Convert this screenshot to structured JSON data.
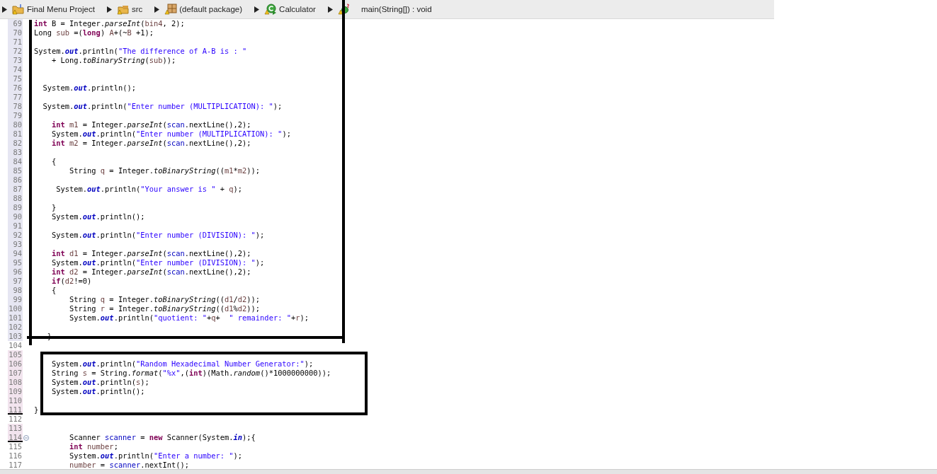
{
  "breadcrumb": [
    {
      "label": "Final Menu Project",
      "kind": "project"
    },
    {
      "label": "src",
      "kind": "folder"
    },
    {
      "label": "(default package)",
      "kind": "package"
    },
    {
      "label": "Calculator",
      "kind": "class"
    },
    {
      "label": "main(String[]) : void",
      "kind": "method"
    }
  ],
  "lines": [
    {
      "number": "69",
      "kind": "tinted",
      "tokens": [
        {
          "kind": "keyword",
          "text": "int"
        },
        {
          "kind": "plain",
          "text": " B = Integer."
        },
        {
          "kind": "static",
          "text": "parseInt"
        },
        {
          "kind": "plain",
          "text": "("
        },
        {
          "kind": "local",
          "text": "bin4"
        },
        {
          "kind": "plain",
          "text": ", 2);"
        }
      ]
    },
    {
      "number": "70",
      "kind": "tinted",
      "tokens": [
        {
          "kind": "plain",
          "text": "Long "
        },
        {
          "kind": "local",
          "text": "sub"
        },
        {
          "kind": "plain",
          "text": " =("
        },
        {
          "kind": "keyword",
          "text": "long"
        },
        {
          "kind": "plain",
          "text": ") "
        },
        {
          "kind": "local",
          "text": "A"
        },
        {
          "kind": "plain",
          "text": "+(~"
        },
        {
          "kind": "local",
          "text": "B"
        },
        {
          "kind": "plain",
          "text": " +1);"
        }
      ]
    },
    {
      "number": "71",
      "kind": "tinted"
    },
    {
      "number": "72",
      "kind": "tinted",
      "tokens": [
        {
          "kind": "plain",
          "text": "System."
        },
        {
          "kind": "field",
          "text": "out"
        },
        {
          "kind": "plain",
          "text": ".println("
        },
        {
          "kind": "string",
          "text": "\"The difference of A-B is : \""
        }
      ]
    },
    {
      "number": "73",
      "kind": "tinted",
      "tokens": [
        {
          "kind": "plain",
          "text": "    + Long."
        },
        {
          "kind": "static",
          "text": "toBinaryString"
        },
        {
          "kind": "plain",
          "text": "("
        },
        {
          "kind": "local",
          "text": "sub"
        },
        {
          "kind": "plain",
          "text": "));"
        }
      ]
    },
    {
      "number": "74",
      "kind": "tinted"
    },
    {
      "number": "75",
      "kind": "tinted"
    },
    {
      "number": "76",
      "kind": "tinted",
      "tokens": [
        {
          "kind": "plain",
          "text": "  System."
        },
        {
          "kind": "field",
          "text": "out"
        },
        {
          "kind": "plain",
          "text": ".println();"
        }
      ]
    },
    {
      "number": "77",
      "kind": "tinted"
    },
    {
      "number": "78",
      "kind": "tinted",
      "tokens": [
        {
          "kind": "plain",
          "text": "  System."
        },
        {
          "kind": "field",
          "text": "out"
        },
        {
          "kind": "plain",
          "text": ".println("
        },
        {
          "kind": "string",
          "text": "\"Enter number (MULTIPLICATION): \""
        },
        {
          "kind": "plain",
          "text": ");"
        }
      ]
    },
    {
      "number": "79",
      "kind": "tinted"
    },
    {
      "number": "80",
      "kind": "tinted",
      "tokens": [
        {
          "kind": "keyword",
          "text": "    int"
        },
        {
          "kind": "local",
          "text": " m1"
        },
        {
          "kind": "plain",
          "text": " = Integer."
        },
        {
          "kind": "static",
          "text": "parseInt"
        },
        {
          "kind": "plain",
          "text": "("
        },
        {
          "kind": "member",
          "text": "scan"
        },
        {
          "kind": "plain",
          "text": ".nextLine(),2);"
        }
      ]
    },
    {
      "number": "81",
      "kind": "tinted",
      "tokens": [
        {
          "kind": "plain",
          "text": "    System."
        },
        {
          "kind": "field",
          "text": "out"
        },
        {
          "kind": "plain",
          "text": ".println("
        },
        {
          "kind": "string",
          "text": "\"Enter number (MULTIPLICATION): \""
        },
        {
          "kind": "plain",
          "text": ");"
        }
      ]
    },
    {
      "number": "82",
      "kind": "tinted",
      "tokens": [
        {
          "kind": "keyword",
          "text": "    int"
        },
        {
          "kind": "local",
          "text": " m2"
        },
        {
          "kind": "plain",
          "text": " = Integer."
        },
        {
          "kind": "static",
          "text": "parseInt"
        },
        {
          "kind": "plain",
          "text": "("
        },
        {
          "kind": "member",
          "text": "scan"
        },
        {
          "kind": "plain",
          "text": ".nextLine(),2);"
        }
      ]
    },
    {
      "number": "83",
      "kind": "tinted"
    },
    {
      "number": "84",
      "kind": "tinted",
      "tokens": [
        {
          "kind": "plain",
          "text": "    {"
        }
      ]
    },
    {
      "number": "85",
      "kind": "tinted",
      "tokens": [
        {
          "kind": "plain",
          "text": "        String "
        },
        {
          "kind": "local",
          "text": "q"
        },
        {
          "kind": "plain",
          "text": " = Integer."
        },
        {
          "kind": "static",
          "text": "toBinaryString"
        },
        {
          "kind": "plain",
          "text": "(("
        },
        {
          "kind": "local",
          "text": "m1"
        },
        {
          "kind": "plain",
          "text": "*"
        },
        {
          "kind": "local",
          "text": "m2"
        },
        {
          "kind": "plain",
          "text": "));"
        }
      ]
    },
    {
      "number": "86",
      "kind": "tinted"
    },
    {
      "number": "87",
      "kind": "tinted",
      "tokens": [
        {
          "kind": "plain",
          "text": "     System."
        },
        {
          "kind": "field",
          "text": "out"
        },
        {
          "kind": "plain",
          "text": ".println("
        },
        {
          "kind": "string",
          "text": "\"Your answer is \""
        },
        {
          "kind": "plain",
          "text": " + "
        },
        {
          "kind": "local",
          "text": "q"
        },
        {
          "kind": "plain",
          "text": ");"
        }
      ]
    },
    {
      "number": "88",
      "kind": "tinted"
    },
    {
      "number": "89",
      "kind": "tinted",
      "tokens": [
        {
          "kind": "plain",
          "text": "    }"
        }
      ]
    },
    {
      "number": "90",
      "kind": "tinted",
      "tokens": [
        {
          "kind": "plain",
          "text": "    System."
        },
        {
          "kind": "field",
          "text": "out"
        },
        {
          "kind": "plain",
          "text": ".println();"
        }
      ]
    },
    {
      "number": "91",
      "kind": "tinted"
    },
    {
      "number": "92",
      "kind": "tinted",
      "tokens": [
        {
          "kind": "plain",
          "text": "    System."
        },
        {
          "kind": "field",
          "text": "out"
        },
        {
          "kind": "plain",
          "text": ".println("
        },
        {
          "kind": "string",
          "text": "\"Enter number (DIVISION): \""
        },
        {
          "kind": "plain",
          "text": ");"
        }
      ]
    },
    {
      "number": "93",
      "kind": "tinted"
    },
    {
      "number": "94",
      "kind": "tinted",
      "tokens": [
        {
          "kind": "keyword",
          "text": "    int"
        },
        {
          "kind": "local",
          "text": " d1"
        },
        {
          "kind": "plain",
          "text": " = Integer."
        },
        {
          "kind": "static",
          "text": "parseInt"
        },
        {
          "kind": "plain",
          "text": "("
        },
        {
          "kind": "member",
          "text": "scan"
        },
        {
          "kind": "plain",
          "text": ".nextLine(),2);"
        }
      ]
    },
    {
      "number": "95",
      "kind": "tinted",
      "tokens": [
        {
          "kind": "plain",
          "text": "    System."
        },
        {
          "kind": "field",
          "text": "out"
        },
        {
          "kind": "plain",
          "text": ".println("
        },
        {
          "kind": "string",
          "text": "\"Enter number (DIVISION): \""
        },
        {
          "kind": "plain",
          "text": ");"
        }
      ]
    },
    {
      "number": "96",
      "kind": "tinted",
      "tokens": [
        {
          "kind": "keyword",
          "text": "    int"
        },
        {
          "kind": "local",
          "text": " d2"
        },
        {
          "kind": "plain",
          "text": " = Integer."
        },
        {
          "kind": "static",
          "text": "parseInt"
        },
        {
          "kind": "plain",
          "text": "("
        },
        {
          "kind": "member",
          "text": "scan"
        },
        {
          "kind": "plain",
          "text": ".nextLine(),2);"
        }
      ]
    },
    {
      "number": "97",
      "kind": "tinted",
      "tokens": [
        {
          "kind": "keyword",
          "text": "    if"
        },
        {
          "kind": "plain",
          "text": "("
        },
        {
          "kind": "local",
          "text": "d2"
        },
        {
          "kind": "plain",
          "text": "!=0)"
        }
      ]
    },
    {
      "number": "98",
      "kind": "tinted",
      "tokens": [
        {
          "kind": "plain",
          "text": "    {"
        }
      ]
    },
    {
      "number": "99",
      "kind": "tinted",
      "tokens": [
        {
          "kind": "plain",
          "text": "        String "
        },
        {
          "kind": "local",
          "text": "q"
        },
        {
          "kind": "plain",
          "text": " = Integer."
        },
        {
          "kind": "static",
          "text": "toBinaryString"
        },
        {
          "kind": "plain",
          "text": "(("
        },
        {
          "kind": "local",
          "text": "d1"
        },
        {
          "kind": "plain",
          "text": "/"
        },
        {
          "kind": "local",
          "text": "d2"
        },
        {
          "kind": "plain",
          "text": "));"
        }
      ]
    },
    {
      "number": "100",
      "kind": "tinted",
      "tokens": [
        {
          "kind": "plain",
          "text": "        String "
        },
        {
          "kind": "local",
          "text": "r"
        },
        {
          "kind": "plain",
          "text": " = Integer."
        },
        {
          "kind": "static",
          "text": "toBinaryString"
        },
        {
          "kind": "plain",
          "text": "(("
        },
        {
          "kind": "local",
          "text": "d1"
        },
        {
          "kind": "plain",
          "text": "%"
        },
        {
          "kind": "local",
          "text": "d2"
        },
        {
          "kind": "plain",
          "text": "));"
        }
      ]
    },
    {
      "number": "101",
      "kind": "tinted",
      "tokens": [
        {
          "kind": "plain",
          "text": "        System."
        },
        {
          "kind": "field",
          "text": "out"
        },
        {
          "kind": "plain",
          "text": ".println("
        },
        {
          "kind": "string",
          "text": "\"quotient: \""
        },
        {
          "kind": "plain",
          "text": "+"
        },
        {
          "kind": "local",
          "text": "q"
        },
        {
          "kind": "plain",
          "text": "+  "
        },
        {
          "kind": "string",
          "text": "\" remainder: \""
        },
        {
          "kind": "plain",
          "text": "+"
        },
        {
          "kind": "local",
          "text": "r"
        },
        {
          "kind": "plain",
          "text": ");"
        }
      ]
    },
    {
      "number": "102",
      "kind": "tinted"
    },
    {
      "number": "103",
      "kind": "tinted",
      "tokens": [
        {
          "kind": "plain",
          "text": "   }"
        }
      ]
    },
    {
      "number": "104",
      "kind": "plain"
    },
    {
      "number": "105",
      "kind": "changed"
    },
    {
      "number": "106",
      "kind": "changed",
      "tokens": [
        {
          "kind": "plain",
          "text": "    System."
        },
        {
          "kind": "field",
          "text": "out"
        },
        {
          "kind": "plain",
          "text": ".println("
        },
        {
          "kind": "string",
          "text": "\"Random Hexadecimal Number Generator:\""
        },
        {
          "kind": "plain",
          "text": ");"
        }
      ]
    },
    {
      "number": "107",
      "kind": "changed",
      "tokens": [
        {
          "kind": "plain",
          "text": "    String "
        },
        {
          "kind": "local",
          "text": "s"
        },
        {
          "kind": "plain",
          "text": " = String."
        },
        {
          "kind": "static",
          "text": "format"
        },
        {
          "kind": "plain",
          "text": "("
        },
        {
          "kind": "string",
          "text": "\"%x\""
        },
        {
          "kind": "plain",
          "text": ",("
        },
        {
          "kind": "keyword",
          "text": "int"
        },
        {
          "kind": "plain",
          "text": ")(Math."
        },
        {
          "kind": "static",
          "text": "random"
        },
        {
          "kind": "plain",
          "text": "()*1000000000));"
        }
      ]
    },
    {
      "number": "108",
      "kind": "changed",
      "tokens": [
        {
          "kind": "plain",
          "text": "    System."
        },
        {
          "kind": "field",
          "text": "out"
        },
        {
          "kind": "plain",
          "text": ".println("
        },
        {
          "kind": "local",
          "text": "s"
        },
        {
          "kind": "plain",
          "text": ");"
        }
      ]
    },
    {
      "number": "109",
      "kind": "changed",
      "tokens": [
        {
          "kind": "plain",
          "text": "    System."
        },
        {
          "kind": "field",
          "text": "out"
        },
        {
          "kind": "plain",
          "text": ".println();"
        }
      ]
    },
    {
      "number": "110",
      "kind": "changed"
    },
    {
      "number": "111",
      "kind": "underlined",
      "tokens": [
        {
          "kind": "plain",
          "text": "}"
        }
      ]
    },
    {
      "number": "112",
      "kind": "plain"
    },
    {
      "number": "113",
      "kind": "changed"
    },
    {
      "number": "114",
      "kind": "foldable",
      "tokens": [
        {
          "kind": "plain",
          "text": "        Scanner "
        },
        {
          "kind": "member",
          "text": "scanner"
        },
        {
          "kind": "plain",
          "text": " = "
        },
        {
          "kind": "keyword",
          "text": "new"
        },
        {
          "kind": "plain",
          "text": " Scanner(System."
        },
        {
          "kind": "field",
          "text": "in"
        },
        {
          "kind": "plain",
          "text": ");{"
        }
      ]
    },
    {
      "number": "115",
      "kind": "plain",
      "tokens": [
        {
          "kind": "keyword",
          "text": "        int"
        },
        {
          "kind": "local",
          "text": " number"
        },
        {
          "kind": "plain",
          "text": ";"
        }
      ]
    },
    {
      "number": "116",
      "kind": "plain",
      "tokens": [
        {
          "kind": "plain",
          "text": "        System."
        },
        {
          "kind": "field",
          "text": "out"
        },
        {
          "kind": "plain",
          "text": ".println("
        },
        {
          "kind": "string",
          "text": "\"Enter a number: \""
        },
        {
          "kind": "plain",
          "text": ");"
        }
      ]
    },
    {
      "number": "117",
      "kind": "plain",
      "tokens": [
        {
          "kind": "local",
          "text": "        number"
        },
        {
          "kind": "plain",
          "text": " = "
        },
        {
          "kind": "member",
          "text": "scanner"
        },
        {
          "kind": "plain",
          "text": ".nextInt();"
        }
      ]
    }
  ]
}
